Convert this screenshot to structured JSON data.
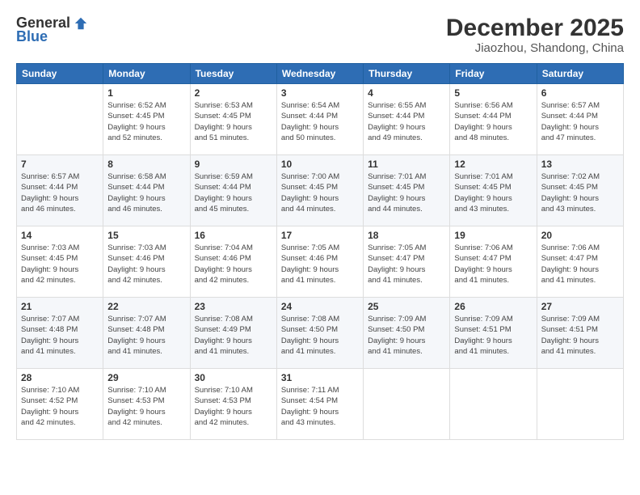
{
  "logo": {
    "general": "General",
    "blue": "Blue"
  },
  "title": "December 2025",
  "location": "Jiaozhou, Shandong, China",
  "days_of_week": [
    "Sunday",
    "Monday",
    "Tuesday",
    "Wednesday",
    "Thursday",
    "Friday",
    "Saturday"
  ],
  "weeks": [
    [
      {
        "day": "",
        "info": ""
      },
      {
        "day": "1",
        "info": "Sunrise: 6:52 AM\nSunset: 4:45 PM\nDaylight: 9 hours\nand 52 minutes."
      },
      {
        "day": "2",
        "info": "Sunrise: 6:53 AM\nSunset: 4:45 PM\nDaylight: 9 hours\nand 51 minutes."
      },
      {
        "day": "3",
        "info": "Sunrise: 6:54 AM\nSunset: 4:44 PM\nDaylight: 9 hours\nand 50 minutes."
      },
      {
        "day": "4",
        "info": "Sunrise: 6:55 AM\nSunset: 4:44 PM\nDaylight: 9 hours\nand 49 minutes."
      },
      {
        "day": "5",
        "info": "Sunrise: 6:56 AM\nSunset: 4:44 PM\nDaylight: 9 hours\nand 48 minutes."
      },
      {
        "day": "6",
        "info": "Sunrise: 6:57 AM\nSunset: 4:44 PM\nDaylight: 9 hours\nand 47 minutes."
      }
    ],
    [
      {
        "day": "7",
        "info": "Sunrise: 6:57 AM\nSunset: 4:44 PM\nDaylight: 9 hours\nand 46 minutes."
      },
      {
        "day": "8",
        "info": "Sunrise: 6:58 AM\nSunset: 4:44 PM\nDaylight: 9 hours\nand 46 minutes."
      },
      {
        "day": "9",
        "info": "Sunrise: 6:59 AM\nSunset: 4:44 PM\nDaylight: 9 hours\nand 45 minutes."
      },
      {
        "day": "10",
        "info": "Sunrise: 7:00 AM\nSunset: 4:45 PM\nDaylight: 9 hours\nand 44 minutes."
      },
      {
        "day": "11",
        "info": "Sunrise: 7:01 AM\nSunset: 4:45 PM\nDaylight: 9 hours\nand 44 minutes."
      },
      {
        "day": "12",
        "info": "Sunrise: 7:01 AM\nSunset: 4:45 PM\nDaylight: 9 hours\nand 43 minutes."
      },
      {
        "day": "13",
        "info": "Sunrise: 7:02 AM\nSunset: 4:45 PM\nDaylight: 9 hours\nand 43 minutes."
      }
    ],
    [
      {
        "day": "14",
        "info": "Sunrise: 7:03 AM\nSunset: 4:45 PM\nDaylight: 9 hours\nand 42 minutes."
      },
      {
        "day": "15",
        "info": "Sunrise: 7:03 AM\nSunset: 4:46 PM\nDaylight: 9 hours\nand 42 minutes."
      },
      {
        "day": "16",
        "info": "Sunrise: 7:04 AM\nSunset: 4:46 PM\nDaylight: 9 hours\nand 42 minutes."
      },
      {
        "day": "17",
        "info": "Sunrise: 7:05 AM\nSunset: 4:46 PM\nDaylight: 9 hours\nand 41 minutes."
      },
      {
        "day": "18",
        "info": "Sunrise: 7:05 AM\nSunset: 4:47 PM\nDaylight: 9 hours\nand 41 minutes."
      },
      {
        "day": "19",
        "info": "Sunrise: 7:06 AM\nSunset: 4:47 PM\nDaylight: 9 hours\nand 41 minutes."
      },
      {
        "day": "20",
        "info": "Sunrise: 7:06 AM\nSunset: 4:47 PM\nDaylight: 9 hours\nand 41 minutes."
      }
    ],
    [
      {
        "day": "21",
        "info": "Sunrise: 7:07 AM\nSunset: 4:48 PM\nDaylight: 9 hours\nand 41 minutes."
      },
      {
        "day": "22",
        "info": "Sunrise: 7:07 AM\nSunset: 4:48 PM\nDaylight: 9 hours\nand 41 minutes."
      },
      {
        "day": "23",
        "info": "Sunrise: 7:08 AM\nSunset: 4:49 PM\nDaylight: 9 hours\nand 41 minutes."
      },
      {
        "day": "24",
        "info": "Sunrise: 7:08 AM\nSunset: 4:50 PM\nDaylight: 9 hours\nand 41 minutes."
      },
      {
        "day": "25",
        "info": "Sunrise: 7:09 AM\nSunset: 4:50 PM\nDaylight: 9 hours\nand 41 minutes."
      },
      {
        "day": "26",
        "info": "Sunrise: 7:09 AM\nSunset: 4:51 PM\nDaylight: 9 hours\nand 41 minutes."
      },
      {
        "day": "27",
        "info": "Sunrise: 7:09 AM\nSunset: 4:51 PM\nDaylight: 9 hours\nand 41 minutes."
      }
    ],
    [
      {
        "day": "28",
        "info": "Sunrise: 7:10 AM\nSunset: 4:52 PM\nDaylight: 9 hours\nand 42 minutes."
      },
      {
        "day": "29",
        "info": "Sunrise: 7:10 AM\nSunset: 4:53 PM\nDaylight: 9 hours\nand 42 minutes."
      },
      {
        "day": "30",
        "info": "Sunrise: 7:10 AM\nSunset: 4:53 PM\nDaylight: 9 hours\nand 42 minutes."
      },
      {
        "day": "31",
        "info": "Sunrise: 7:11 AM\nSunset: 4:54 PM\nDaylight: 9 hours\nand 43 minutes."
      },
      {
        "day": "",
        "info": ""
      },
      {
        "day": "",
        "info": ""
      },
      {
        "day": "",
        "info": ""
      }
    ]
  ]
}
